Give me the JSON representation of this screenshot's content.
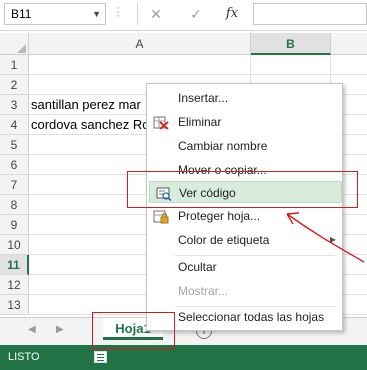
{
  "formula_bar": {
    "name_box": "B11",
    "name_box_arrow": "▼",
    "dots": "⋮",
    "cancel": "✕",
    "enter": "✓",
    "fx": "fx",
    "formula_value": ""
  },
  "columns": [
    "A",
    "B"
  ],
  "rows": [
    {
      "num": "1",
      "a": ""
    },
    {
      "num": "2",
      "a": ""
    },
    {
      "num": "3",
      "a": "santillan perez mar"
    },
    {
      "num": "4",
      "a": "cordova sanchez Ro"
    },
    {
      "num": "5",
      "a": ""
    },
    {
      "num": "6",
      "a": ""
    },
    {
      "num": "7",
      "a": ""
    },
    {
      "num": "8",
      "a": ""
    },
    {
      "num": "9",
      "a": ""
    },
    {
      "num": "10",
      "a": ""
    },
    {
      "num": "11",
      "a": ""
    },
    {
      "num": "12",
      "a": ""
    },
    {
      "num": "13",
      "a": ""
    }
  ],
  "sheet_tabs": {
    "prev": "◀",
    "next": "▶",
    "active": "Hoja1",
    "add": "+"
  },
  "status": {
    "text": "LISTO"
  },
  "context_menu": {
    "items": [
      {
        "label": "Insertar...",
        "icon": ""
      },
      {
        "label": "Eliminar",
        "icon": "delete-sheet-icon"
      },
      {
        "label": "Cambiar nombre",
        "icon": ""
      },
      {
        "label": "Mover o copiar...",
        "icon": ""
      },
      {
        "label": "Ver código",
        "icon": "view-code-icon",
        "state": "hover"
      },
      {
        "label": "Proteger hoja...",
        "icon": "protect-sheet-icon"
      },
      {
        "label": "Color de etiqueta",
        "icon": "",
        "submenu": "▶"
      },
      {
        "label": "Ocultar",
        "icon": ""
      },
      {
        "label": "Mostrar...",
        "icon": "",
        "state": "disabled"
      },
      {
        "label": "Seleccionar todas las hojas",
        "icon": ""
      }
    ]
  },
  "annotation_color": "#d11d1d",
  "accent_color": "#217346"
}
